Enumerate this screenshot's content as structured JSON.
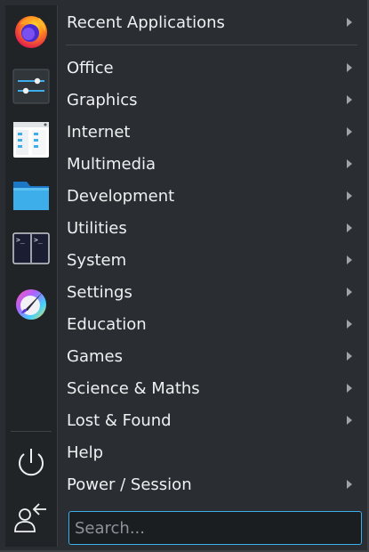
{
  "favorites": [
    {
      "name": "firefox-icon",
      "app": "Firefox"
    },
    {
      "name": "system-settings-icon",
      "app": "System Settings"
    },
    {
      "name": "file-manager-icon",
      "app": "File Manager"
    },
    {
      "name": "folder-icon",
      "app": "Files"
    },
    {
      "name": "terminal-icon",
      "app": "Terminal"
    },
    {
      "name": "krita-icon",
      "app": "Krita"
    }
  ],
  "session": [
    {
      "name": "power-icon",
      "label": "Shut Down"
    },
    {
      "name": "logout-icon",
      "label": "Log Out"
    }
  ],
  "menu": {
    "items": [
      {
        "label": "Recent Applications",
        "submenu": true
      },
      {
        "label": "Office",
        "submenu": true
      },
      {
        "label": "Graphics",
        "submenu": true
      },
      {
        "label": "Internet",
        "submenu": true
      },
      {
        "label": "Multimedia",
        "submenu": true
      },
      {
        "label": "Development",
        "submenu": true
      },
      {
        "label": "Utilities",
        "submenu": true
      },
      {
        "label": "System",
        "submenu": true
      },
      {
        "label": "Settings",
        "submenu": true
      },
      {
        "label": "Education",
        "submenu": true
      },
      {
        "label": "Games",
        "submenu": true
      },
      {
        "label": "Science & Maths",
        "submenu": true
      },
      {
        "label": "Lost & Found",
        "submenu": true
      },
      {
        "label": "Help",
        "submenu": false
      },
      {
        "label": "Power / Session",
        "submenu": true
      }
    ]
  },
  "search": {
    "placeholder": "Search...",
    "value": ""
  },
  "colors": {
    "background": "#2a2e32",
    "panel": "#212427",
    "text": "#eff0f1",
    "accent": "#3daee9",
    "chevron": "#9ea3a8"
  }
}
